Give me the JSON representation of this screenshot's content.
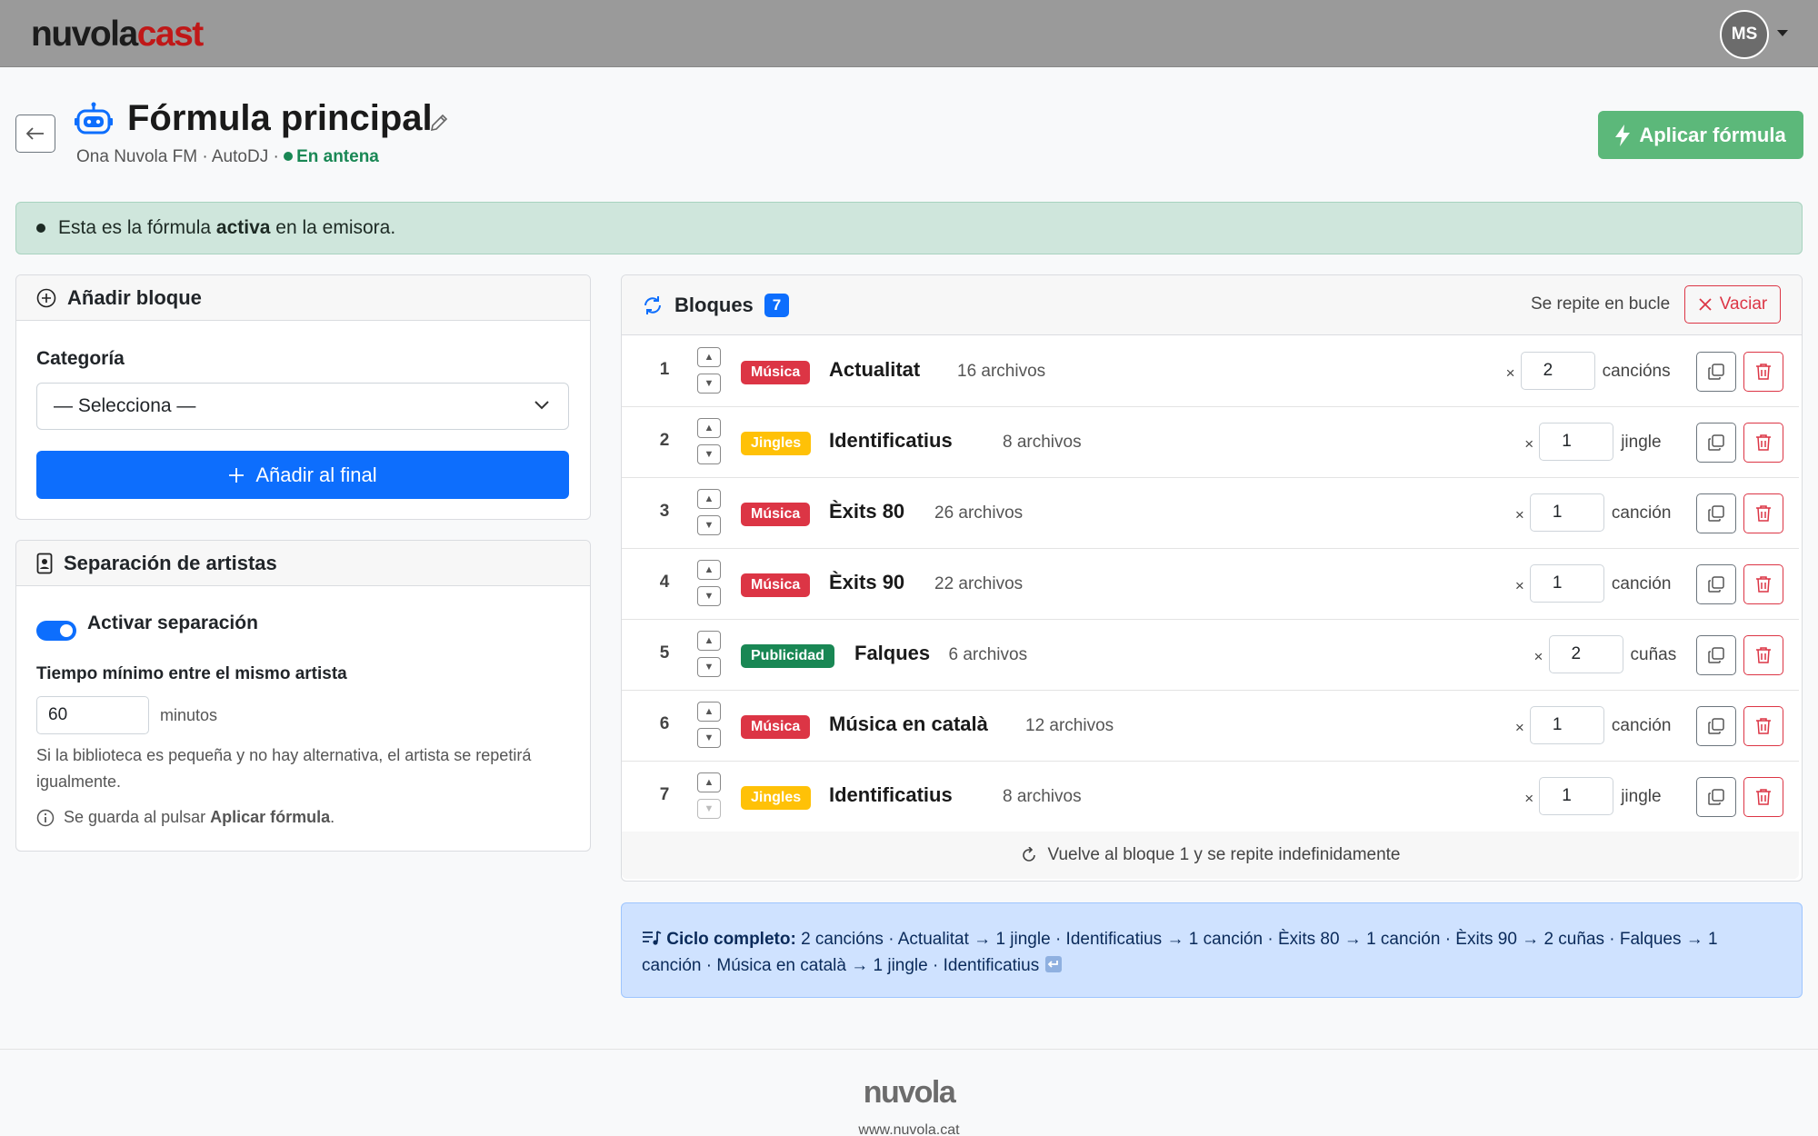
{
  "brand": {
    "logo_part1": "nuvola",
    "logo_part2": "cast",
    "primary": "#0d6efd",
    "danger": "#dc3545",
    "success": "#198754"
  },
  "user": {
    "initials": "MS"
  },
  "header": {
    "title": "Fórmula principal",
    "station": "Ona Nuvola FM · AutoDJ · ",
    "status": "En antena",
    "apply_label": "Aplicar fórmula"
  },
  "alert": {
    "text_before": "Esta es la fórmula ",
    "text_bold": "activa",
    "text_after": " en la emisora."
  },
  "add_block": {
    "title": "Añadir bloque",
    "category_label": "Categoría",
    "category_value": "— Selecciona —",
    "add_label": "Añadir al final"
  },
  "separation": {
    "title": "Separación de artistas",
    "toggle_label": "Activar separación",
    "toggle_on": true,
    "min_time_label": "Tiempo mínimo entre el mismo artista",
    "min_time_value": "60",
    "min_time_unit": "minutos",
    "help": "Si la biblioteca es pequeña y no hay alternativa, el artista se repetirá igualmente.",
    "note_before": "Se guarda al pulsar ",
    "note_bold": "Aplicar fórmula",
    "note_after": "."
  },
  "blocks": {
    "title": "Bloques",
    "count": "7",
    "loop_text": "Se repite en bucle",
    "clear_label": "Vaciar",
    "footer": "Vuelve al bloque 1 y se repite indefinidamente",
    "items": [
      {
        "num": "1",
        "tag": "Música",
        "name": "Actualitat",
        "files": "16 archivos",
        "times": "×",
        "qty": "2",
        "unit": "cancións"
      },
      {
        "num": "2",
        "tag": "Jingles",
        "name": "Identificatius",
        "files": "8 archivos",
        "times": "×",
        "qty": "1",
        "unit": "jingle"
      },
      {
        "num": "3",
        "tag": "Música",
        "name": "Èxits 80",
        "files": "26 archivos",
        "times": "×",
        "qty": "1",
        "unit": "canción"
      },
      {
        "num": "4",
        "tag": "Música",
        "name": "Èxits 90",
        "files": "22 archivos",
        "times": "×",
        "qty": "1",
        "unit": "canción"
      },
      {
        "num": "5",
        "tag": "Publicidad",
        "name": "Falques",
        "files": "6 archivos",
        "times": "×",
        "qty": "2",
        "unit": "cuñas"
      },
      {
        "num": "6",
        "tag": "Música",
        "name": "Música en català",
        "files": "12 archivos",
        "times": "×",
        "qty": "1",
        "unit": "canción"
      },
      {
        "num": "7",
        "tag": "Jingles",
        "name": "Identificatius",
        "files": "8 archivos",
        "times": "×",
        "qty": "1",
        "unit": "jingle"
      }
    ]
  },
  "cycle": {
    "label": "Ciclo completo:",
    "text": " 2 cancións · Actualitat → 1 jingle · Identificatius → 1 canción · Èxits 80 → 1 canción · Èxits 90 → 2 cuñas · Falques → 1 canción · Música en català → 1 jingle · Identificatius"
  },
  "footer": {
    "logo": "nuvola",
    "url": "www.nuvola.cat"
  }
}
